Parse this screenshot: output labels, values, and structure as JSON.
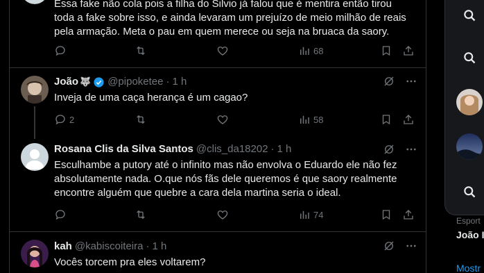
{
  "tweets": [
    {
      "text_lines": [
        "Essa fake não cola pois a filha do Silvio já falou que é mentira então tirou",
        "toda a fake sobre isso, e ainda levaram um prejuízo de meio milhão de reais",
        "pela armação. Meta o pau em quem merece ou seja na bruaca da saory."
      ],
      "views": "68"
    },
    {
      "name": "João",
      "emoji": "🐺",
      "handle": "@pipoketee",
      "dot": "·",
      "time": "1 h",
      "text_lines": [
        "Inveja de uma caça herança é um cagao?"
      ],
      "replies": "2",
      "views": "58"
    },
    {
      "name": "Rosana Clis da Silva Santos",
      "handle": "@clis_da18202",
      "dot": "·",
      "time": "1 h",
      "text_lines": [
        "Esculhambe a putory até o infinito mas não envolva o Eduardo ele não fez",
        "absolutamente nada. O.que nós fãs dele queremos é que saory realmente",
        "encontre alguém que quebre a cara dela martina seria o ideal."
      ],
      "views": "74"
    },
    {
      "name": "kah",
      "handle": "@kabiscoiteira",
      "dot": "·",
      "time": "1 h",
      "text_lines": [
        "Vocês torcem pra eles voltarem?"
      ]
    }
  ],
  "sidebar": {
    "label_cut": "Esport",
    "name_cut": "João I",
    "more_cut": "Mostr"
  },
  "colors": {
    "background": "#000000",
    "text": "#e7e9ea",
    "muted": "#71767b",
    "border": "#2f3336",
    "accent": "#1d9bf0"
  }
}
